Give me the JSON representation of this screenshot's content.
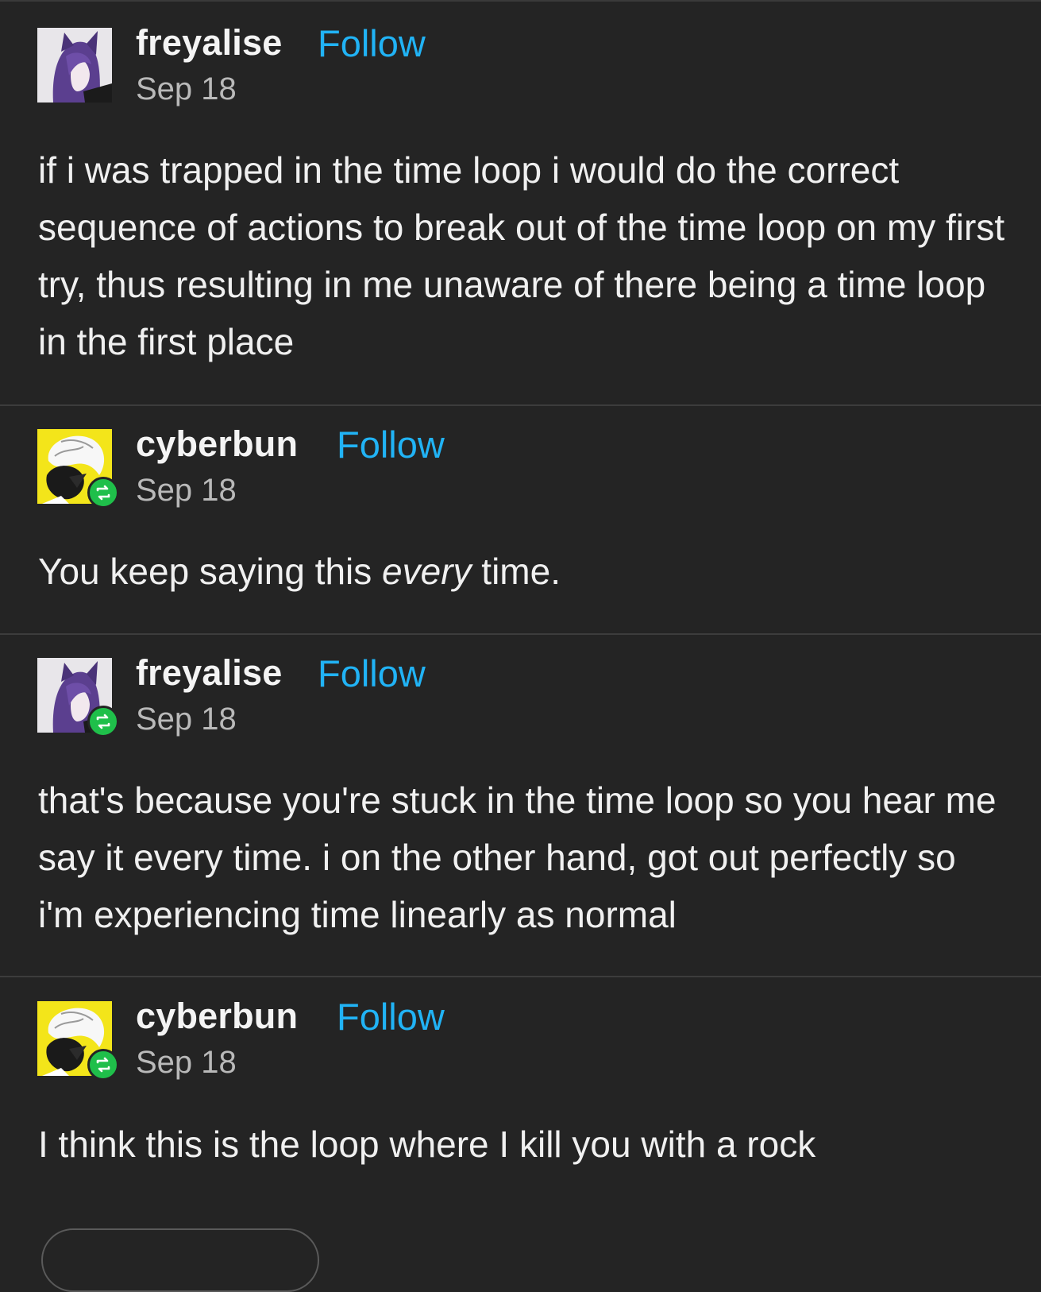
{
  "thread": [
    {
      "username": "freyalise",
      "follow_label": "Follow",
      "date": "Sep 18",
      "avatar": "purple-haired-character-avatar",
      "is_reblog": false,
      "text": "if i was trapped in the time loop i would do the correct sequence of actions to break out of the time loop on my first try, thus resulting in me unaware of there being a time loop in the first place"
    },
    {
      "username": "cyberbun",
      "follow_label": "Follow",
      "date": "Sep 18",
      "avatar": "yellow-background-white-haired-character-avatar",
      "is_reblog": true,
      "text_before": "You keep saying this ",
      "text_emphasis": "every",
      "text_after": " time."
    },
    {
      "username": "freyalise",
      "follow_label": "Follow",
      "date": "Sep 18",
      "avatar": "purple-haired-character-avatar",
      "is_reblog": true,
      "text": "that's because you're stuck in the time loop so you hear me say it every time. i on the other hand, got out perfectly so i'm experiencing time linearly as normal"
    },
    {
      "username": "cyberbun",
      "follow_label": "Follow",
      "date": "Sep 18",
      "avatar": "yellow-background-white-haired-character-avatar",
      "is_reblog": true,
      "text": "I think this is the loop where I kill you with a rock"
    }
  ],
  "colors": {
    "background": "#242424",
    "follow_link": "#21b3f5",
    "reblog_badge": "#1fbf4a",
    "date_text": "#b9b9b9",
    "divider": "#3c3c3c"
  }
}
